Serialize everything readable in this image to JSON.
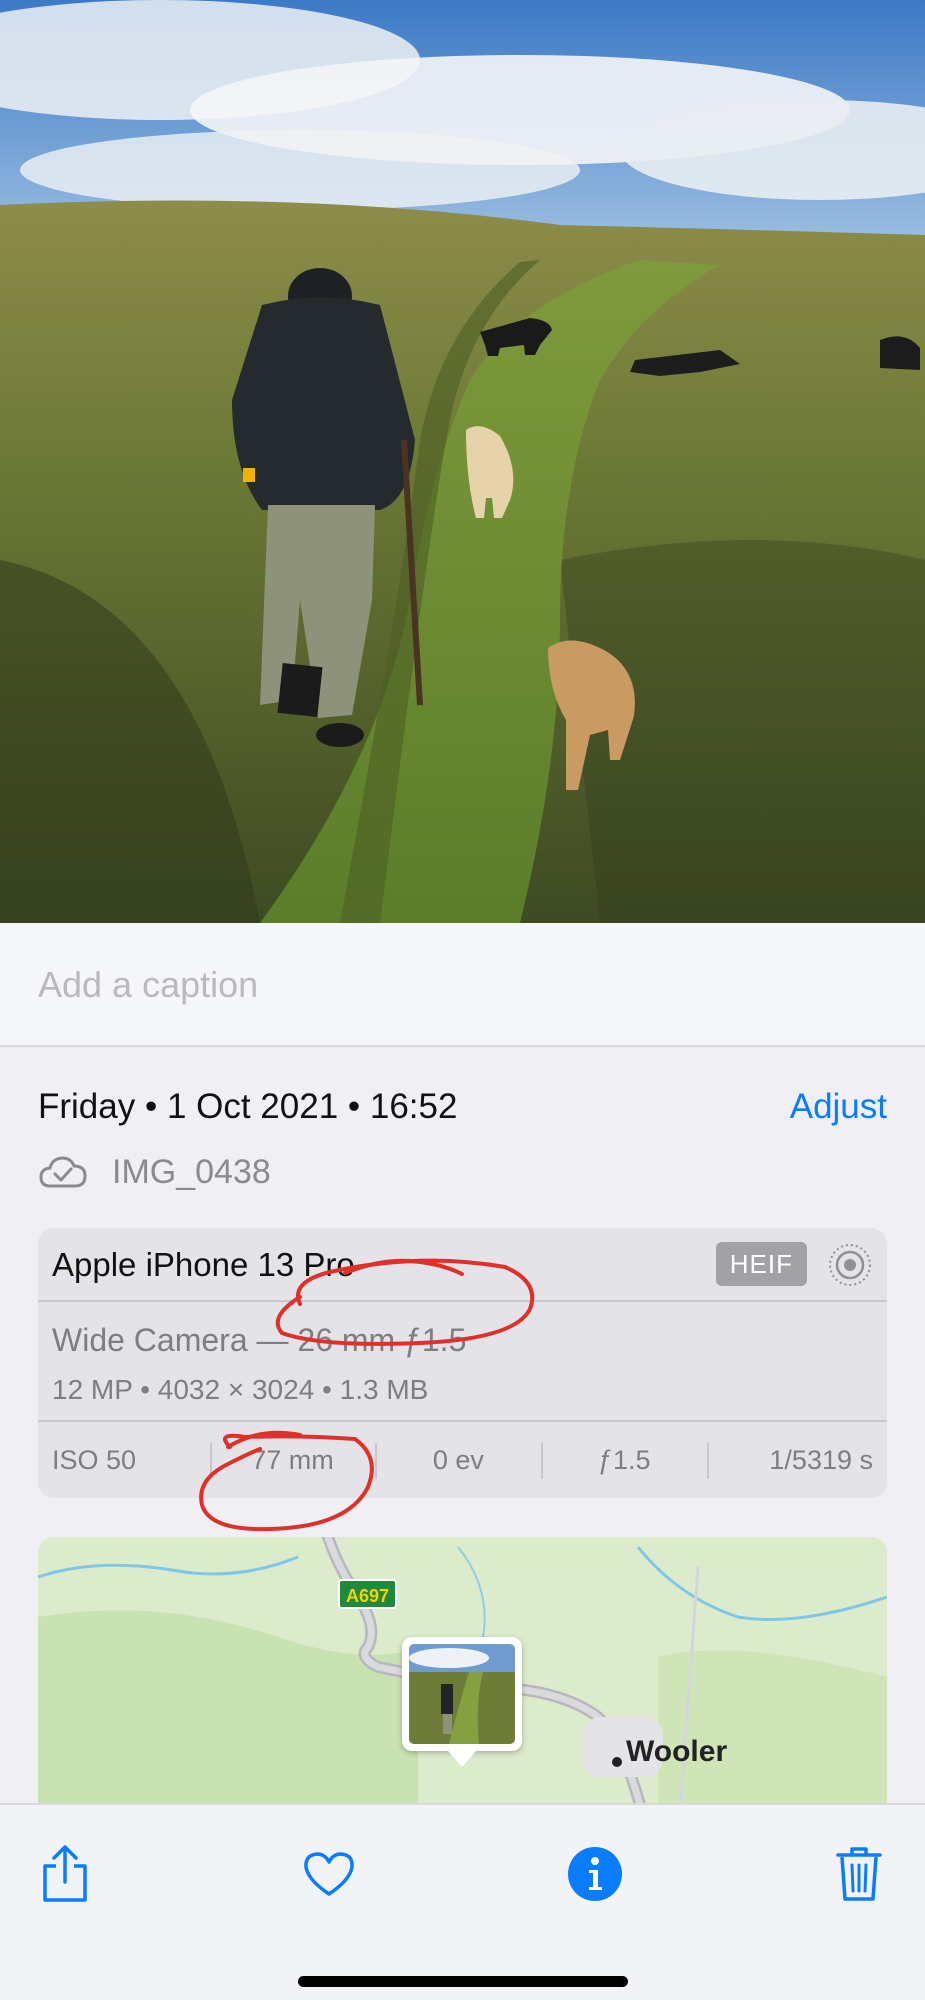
{
  "caption": {
    "placeholder": "Add a caption"
  },
  "header": {
    "date_line": "Friday • 1 Oct 2021 • 16:52",
    "adjust_label": "Adjust"
  },
  "file": {
    "name": "IMG_0438",
    "icon": "icloud-check-icon"
  },
  "camera": {
    "device": "Apple iPhone 13 Pro",
    "format_badge": "HEIF",
    "live_icon": "live-photo-icon",
    "lens_line": "Wide Camera — 26 mm ƒ1.5",
    "spec_line": "12 MP  •  4032 × 3024  •  1.3 MB",
    "exif": {
      "iso": "ISO 50",
      "focal": "77 mm",
      "ev": "0 ev",
      "aperture": "ƒ1.5",
      "shutter": "1/5319 s"
    }
  },
  "map": {
    "road_badge": "A697",
    "place": "Wooler"
  },
  "toolbar": {
    "share_icon": "share-icon",
    "favorite_icon": "heart-icon",
    "info_icon": "info-icon",
    "delete_icon": "trash-icon"
  },
  "colors": {
    "accent": "#0a7cff",
    "annotation": "#e0302a",
    "background": "#efeff4"
  }
}
